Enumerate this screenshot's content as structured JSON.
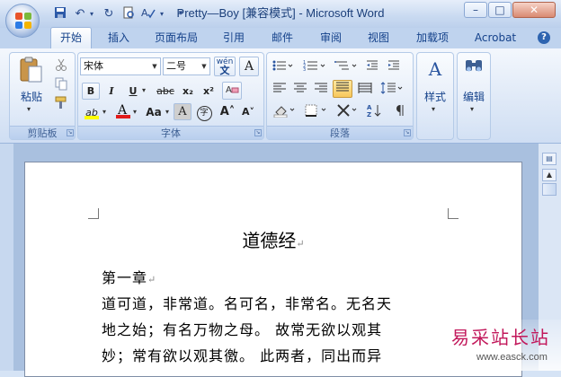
{
  "window": {
    "title": "Pretty—Boy [兼容模式] - Microsoft Word",
    "controls": [
      "–",
      "□",
      "✕"
    ]
  },
  "quick_access": {
    "save": "💾",
    "undo": "↶",
    "redo": "↻",
    "more": "▾"
  },
  "tabs": [
    "开始",
    "插入",
    "页面布局",
    "引用",
    "邮件",
    "审阅",
    "视图",
    "加载项",
    "Acrobat"
  ],
  "help_label": "?",
  "clipboard": {
    "label": "剪贴板",
    "paste": "粘贴"
  },
  "font": {
    "label": "字体",
    "family": "宋体",
    "size": "二号",
    "phonetic": "wén",
    "bold": "B",
    "italic": "I",
    "underline": "U",
    "strike": "abc",
    "sub": "x₂",
    "sup": "x²",
    "highlight": "ab",
    "fontcolor": "A",
    "case": "Aa",
    "shade": "A",
    "enclose": "字",
    "grow": "A˄",
    "shrink": "A˅",
    "border": "A"
  },
  "paragraph": {
    "label": "段落"
  },
  "styles": {
    "label": "样式",
    "icon_text": "A"
  },
  "editing": {
    "label": "编辑",
    "icon_text": "αα"
  },
  "document": {
    "title": "道德经",
    "lines": [
      "第一章",
      "道可道，非常道。名可名，非常名。无名天",
      "地之始；有名万物之母。  故常无欲以观其",
      "妙；常有欲以观其徼。  此两者，同出而异"
    ],
    "para_mark": "↵"
  },
  "watermark": {
    "text": "易采站长站",
    "url": "www.easck.com"
  },
  "colors": {
    "accent": "#15428b",
    "highlight_yellow": "#ffff00",
    "font_red": "#e21b1b"
  }
}
